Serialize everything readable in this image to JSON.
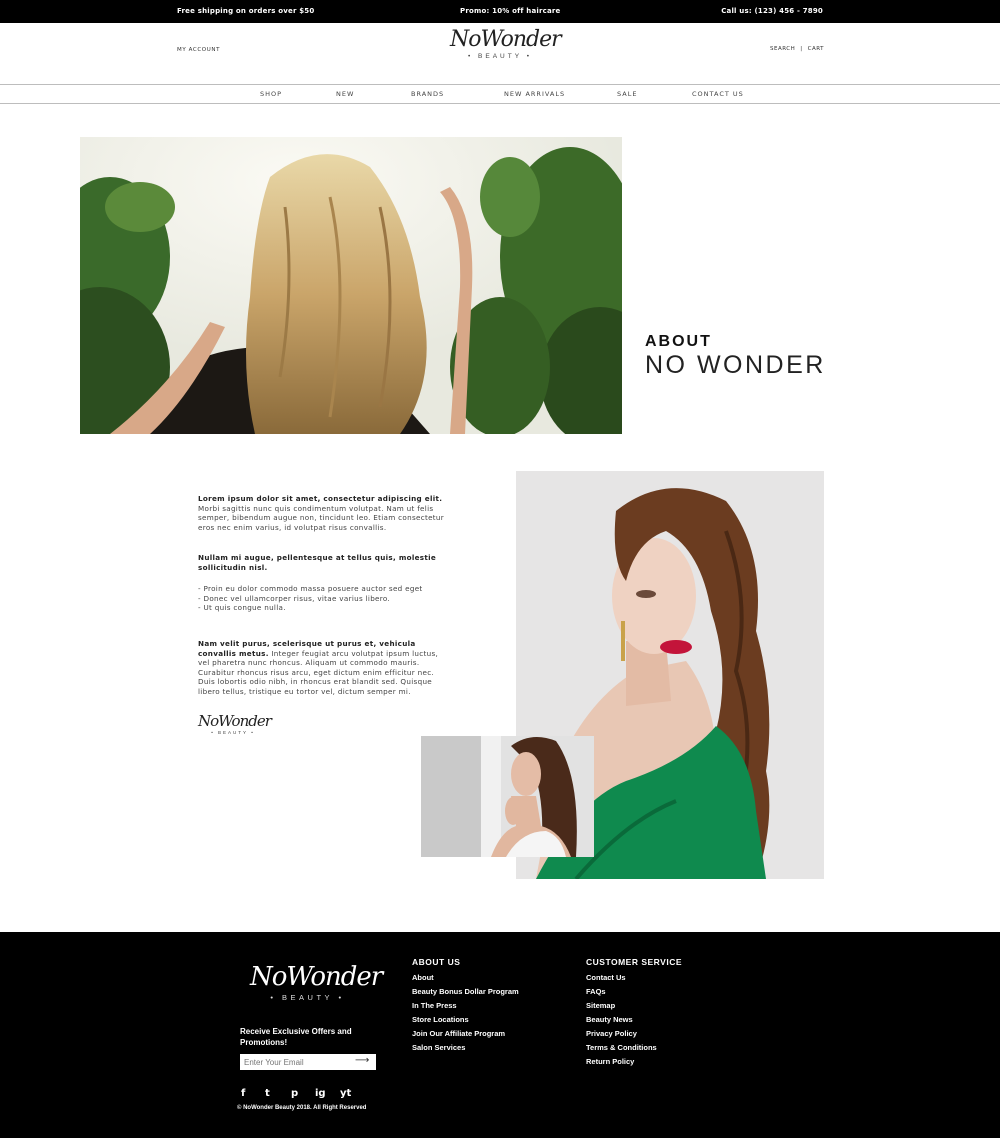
{
  "topbar": {
    "shipping": "Free shipping on orders over $50",
    "promo": "Promo: 10% off haircare",
    "phone": "Call us: (123) 456 - 7890"
  },
  "header": {
    "my_account": "MY ACCOUNT",
    "logo_script": "NoWonder",
    "logo_sub": "• BEAUTY •",
    "search": "SEARCH",
    "separator": "|",
    "cart": "CART"
  },
  "nav": {
    "items": [
      {
        "label": "SHOP"
      },
      {
        "label": "NEW"
      },
      {
        "label": "BRANDS"
      },
      {
        "label": "NEW ARRIVALS"
      },
      {
        "label": "SALE"
      },
      {
        "label": "CONTACT US"
      }
    ]
  },
  "about": {
    "title": "ABOUT",
    "subtitle": "NO WONDER"
  },
  "content": {
    "p1_bold": "Lorem ipsum dolor sit amet, consectetur adipiscing elit.",
    "p1_text": "Morbi sagittis nunc quis condimentum volutpat. Nam ut felis semper, bibendum augue non, tincidunt leo. Etiam consectetur eros nec enim varius, id volutpat risus convallis.",
    "p2_bold": "Nullam mi augue, pellentesque at tellus quis, molestie sollicitudin nisl.",
    "list": [
      "- Proin eu dolor commodo massa posuere auctor sed eget",
      "- Donec vel ullamcorper risus, vitae varius libero.",
      "- Ut quis congue nulla."
    ],
    "p3_bold": "Nam velit purus, scelerisque ut purus et, vehicula convallis metus.",
    "p3_text": " Integer feugiat arcu volutpat ipsum luctus, vel pharetra nunc rhoncus. Aliquam ut commodo mauris. Curabitur rhoncus risus arcu, eget dictum enim efficitur nec. Duis lobortis odio nibh, in rhoncus erat blandit sed. Quisque libero tellus, tristique eu tortor vel, dictum semper mi.",
    "sig_script": "NoWonder",
    "sig_sub": "• BEAUTY •"
  },
  "footer": {
    "logo_script": "NoWonder",
    "logo_sub": "• BEAUTY •",
    "offer": "Receive Exclusive Offers and Promotions!",
    "email_placeholder": "Enter Your Email",
    "social": [
      "f",
      "t",
      "p",
      "ig",
      "yt"
    ],
    "copyright": "© NoWonder Beauty  2018. All Right Reserved",
    "col1": {
      "title": "ABOUT US",
      "links": [
        "About",
        "Beauty Bonus Dollar Program",
        "In The Press",
        "Store Locations",
        "Join Our Affiliate Program",
        "Salon Services"
      ]
    },
    "col2": {
      "title": "CUSTOMER SERVICE",
      "links": [
        "Contact Us",
        "FAQs",
        "Sitemap",
        "Beauty News",
        "Privacy Policy",
        "Terms & Conditions",
        "Return Policy"
      ]
    }
  }
}
